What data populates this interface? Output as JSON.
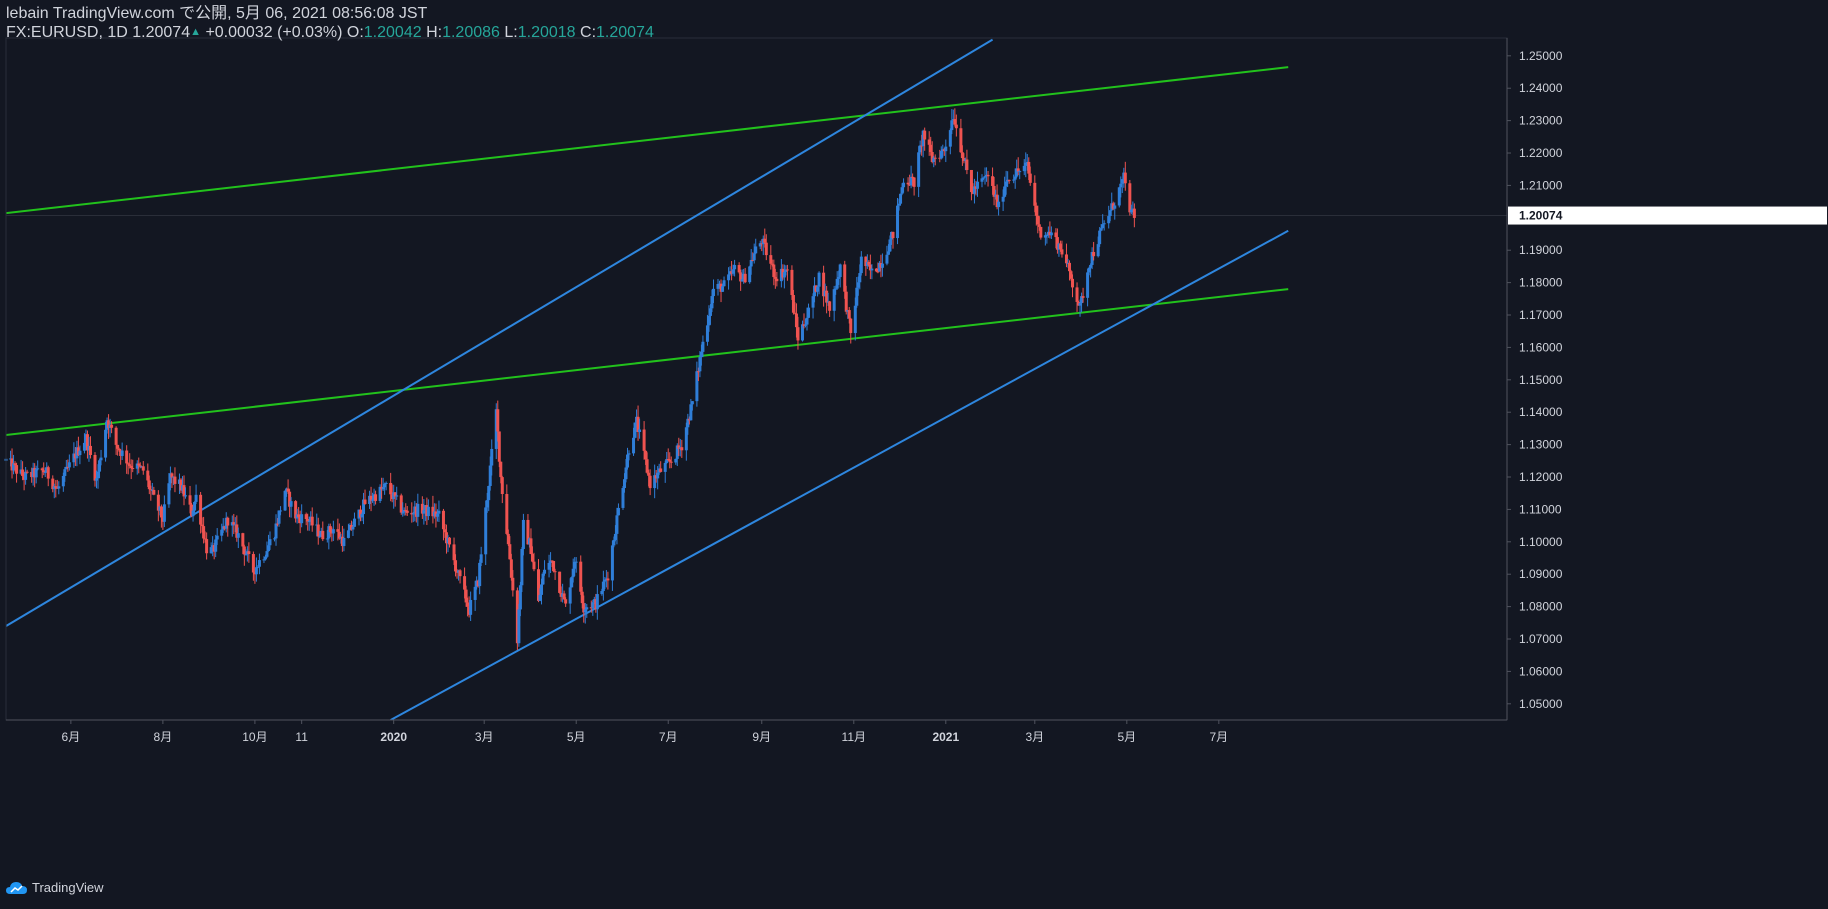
{
  "header": {
    "publish_line": "lebain TradingView.com で公開, 5月 06, 2021 08:56:08 JST",
    "symbol": "FX:EURUSD, 1D",
    "last": "1.20074",
    "change": "+0.00032 (+0.03%)",
    "o_label": "O:",
    "o_value": "1.20042",
    "h_label": "H:",
    "h_value": "1.20086",
    "l_label": "L:",
    "l_value": "1.20018",
    "c_label": "C:",
    "c_value": "1.20074"
  },
  "footer": {
    "brand": "TradingView"
  },
  "colors": {
    "background": "#131722",
    "up": "#2f7ed8",
    "down": "#ef5350",
    "green_line": "#22c21c",
    "blue_line": "#2e86de",
    "price_tag_bg": "#ffffff",
    "teal": "#26a69a"
  },
  "chart_data": {
    "type": "candlestick",
    "symbol": "FX:EURUSD",
    "timeframe": "1D",
    "ylim": [
      1.045,
      1.2555
    ],
    "y_ticks": [
      "1.25000",
      "1.24000",
      "1.23000",
      "1.22000",
      "1.21000",
      "1.19000",
      "1.18000",
      "1.17000",
      "1.16000",
      "1.15000",
      "1.14000",
      "1.13000",
      "1.12000",
      "1.11000",
      "1.10000",
      "1.09000",
      "1.08000",
      "1.07000",
      "1.06000",
      "1.05000"
    ],
    "last_price_label": "1.20074",
    "x_ticks": [
      {
        "label": "6月",
        "date": "2019-06-01"
      },
      {
        "label": "8月",
        "date": "2019-08-01"
      },
      {
        "label": "10月",
        "date": "2019-10-01"
      },
      {
        "label": "11",
        "date": "2019-11-01"
      },
      {
        "label": "2020",
        "date": "2020-01-01",
        "bold": true
      },
      {
        "label": "3月",
        "date": "2020-03-01"
      },
      {
        "label": "5月",
        "date": "2020-05-01"
      },
      {
        "label": "7月",
        "date": "2020-07-01"
      },
      {
        "label": "9月",
        "date": "2020-09-01"
      },
      {
        "label": "11月",
        "date": "2020-11-01"
      },
      {
        "label": "2021",
        "date": "2021-01-01",
        "bold": true
      },
      {
        "label": "3月",
        "date": "2021-03-01"
      },
      {
        "label": "5月",
        "date": "2021-05-01"
      },
      {
        "label": "7月",
        "date": "2021-07-01"
      }
    ],
    "price_path": [
      [
        "2019-04-19",
        1.125
      ],
      [
        "2019-05-01",
        1.12
      ],
      [
        "2019-05-15",
        1.122
      ],
      [
        "2019-05-23",
        1.116
      ],
      [
        "2019-06-04",
        1.127
      ],
      [
        "2019-06-11",
        1.132
      ],
      [
        "2019-06-18",
        1.119
      ],
      [
        "2019-06-25",
        1.138
      ],
      [
        "2019-07-01",
        1.13
      ],
      [
        "2019-07-10",
        1.124
      ],
      [
        "2019-07-19",
        1.122
      ],
      [
        "2019-07-26",
        1.113
      ],
      [
        "2019-08-01",
        1.107
      ],
      [
        "2019-08-06",
        1.12
      ],
      [
        "2019-08-13",
        1.117
      ],
      [
        "2019-08-20",
        1.109
      ],
      [
        "2019-08-23",
        1.114
      ],
      [
        "2019-08-30",
        1.098
      ],
      [
        "2019-09-03",
        1.097
      ],
      [
        "2019-09-13",
        1.107
      ],
      [
        "2019-09-20",
        1.102
      ],
      [
        "2019-09-30",
        1.091
      ],
      [
        "2019-10-08",
        1.097
      ],
      [
        "2019-10-14",
        1.103
      ],
      [
        "2019-10-21",
        1.116
      ],
      [
        "2019-10-28",
        1.108
      ],
      [
        "2019-11-05",
        1.107
      ],
      [
        "2019-11-14",
        1.102
      ],
      [
        "2019-11-22",
        1.104
      ],
      [
        "2019-11-29",
        1.1
      ],
      [
        "2019-12-06",
        1.106
      ],
      [
        "2019-12-13",
        1.112
      ],
      [
        "2019-12-27",
        1.117
      ],
      [
        "2020-01-08",
        1.109
      ],
      [
        "2020-01-20",
        1.11
      ],
      [
        "2020-01-31",
        1.108
      ],
      [
        "2020-02-10",
        1.094
      ],
      [
        "2020-02-20",
        1.079
      ],
      [
        "2020-02-26",
        1.088
      ],
      [
        "2020-03-03",
        1.114
      ],
      [
        "2020-03-09",
        1.14
      ],
      [
        "2020-03-12",
        1.12
      ],
      [
        "2020-03-18",
        1.095
      ],
      [
        "2020-03-23",
        1.07
      ],
      [
        "2020-03-27",
        1.105
      ],
      [
        "2020-04-01",
        1.098
      ],
      [
        "2020-04-06",
        1.081
      ],
      [
        "2020-04-10",
        1.092
      ],
      [
        "2020-04-15",
        1.094
      ],
      [
        "2020-04-24",
        1.08
      ],
      [
        "2020-04-30",
        1.095
      ],
      [
        "2020-05-06",
        1.08
      ],
      [
        "2020-05-14",
        1.081
      ],
      [
        "2020-05-22",
        1.09
      ],
      [
        "2020-05-29",
        1.11
      ],
      [
        "2020-06-05",
        1.129
      ],
      [
        "2020-06-10",
        1.137
      ],
      [
        "2020-06-19",
        1.118
      ],
      [
        "2020-06-26",
        1.122
      ],
      [
        "2020-07-03",
        1.125
      ],
      [
        "2020-07-10",
        1.13
      ],
      [
        "2020-07-17",
        1.143
      ],
      [
        "2020-07-23",
        1.159
      ],
      [
        "2020-07-31",
        1.178
      ],
      [
        "2020-08-07",
        1.179
      ],
      [
        "2020-08-14",
        1.184
      ],
      [
        "2020-08-20",
        1.181
      ],
      [
        "2020-08-28",
        1.19
      ],
      [
        "2020-09-01",
        1.193
      ],
      [
        "2020-09-10",
        1.182
      ],
      [
        "2020-09-18",
        1.184
      ],
      [
        "2020-09-25",
        1.163
      ],
      [
        "2020-10-02",
        1.171
      ],
      [
        "2020-10-09",
        1.182
      ],
      [
        "2020-10-16",
        1.172
      ],
      [
        "2020-10-23",
        1.185
      ],
      [
        "2020-10-30",
        1.164
      ],
      [
        "2020-11-06",
        1.187
      ],
      [
        "2020-11-13",
        1.183
      ],
      [
        "2020-11-20",
        1.187
      ],
      [
        "2020-11-27",
        1.195
      ],
      [
        "2020-12-04",
        1.212
      ],
      [
        "2020-12-11",
        1.211
      ],
      [
        "2020-12-17",
        1.226
      ],
      [
        "2020-12-23",
        1.218
      ],
      [
        "2020-12-31",
        1.221
      ],
      [
        "2021-01-06",
        1.232
      ],
      [
        "2021-01-12",
        1.22
      ],
      [
        "2021-01-18",
        1.208
      ],
      [
        "2021-01-29",
        1.213
      ],
      [
        "2021-02-05",
        1.203
      ],
      [
        "2021-02-10",
        1.212
      ],
      [
        "2021-02-24",
        1.216
      ],
      [
        "2021-03-04",
        1.196
      ],
      [
        "2021-03-12",
        1.195
      ],
      [
        "2021-03-19",
        1.19
      ],
      [
        "2021-03-26",
        1.18
      ],
      [
        "2021-03-31",
        1.172
      ],
      [
        "2021-04-06",
        1.186
      ],
      [
        "2021-04-15",
        1.197
      ],
      [
        "2021-04-21",
        1.203
      ],
      [
        "2021-04-29",
        1.212
      ],
      [
        "2021-05-04",
        1.201
      ],
      [
        "2021-05-06",
        1.2007
      ]
    ],
    "trendlines": [
      {
        "color": "green",
        "p1": [
          "2019-04-01",
          1.132
        ],
        "p2": [
          "2021-08-16",
          1.178
        ]
      },
      {
        "color": "green",
        "p1": [
          "2019-04-01",
          1.2005
        ],
        "p2": [
          "2021-08-16",
          1.2465
        ]
      },
      {
        "color": "blue",
        "p1": [
          "2019-04-01",
          1.069
        ],
        "p2": [
          "2021-02-01",
          1.255
        ]
      },
      {
        "color": "blue",
        "p1": [
          "2019-12-30",
          1.045
        ],
        "p2": [
          "2021-08-16",
          1.196
        ]
      }
    ]
  }
}
